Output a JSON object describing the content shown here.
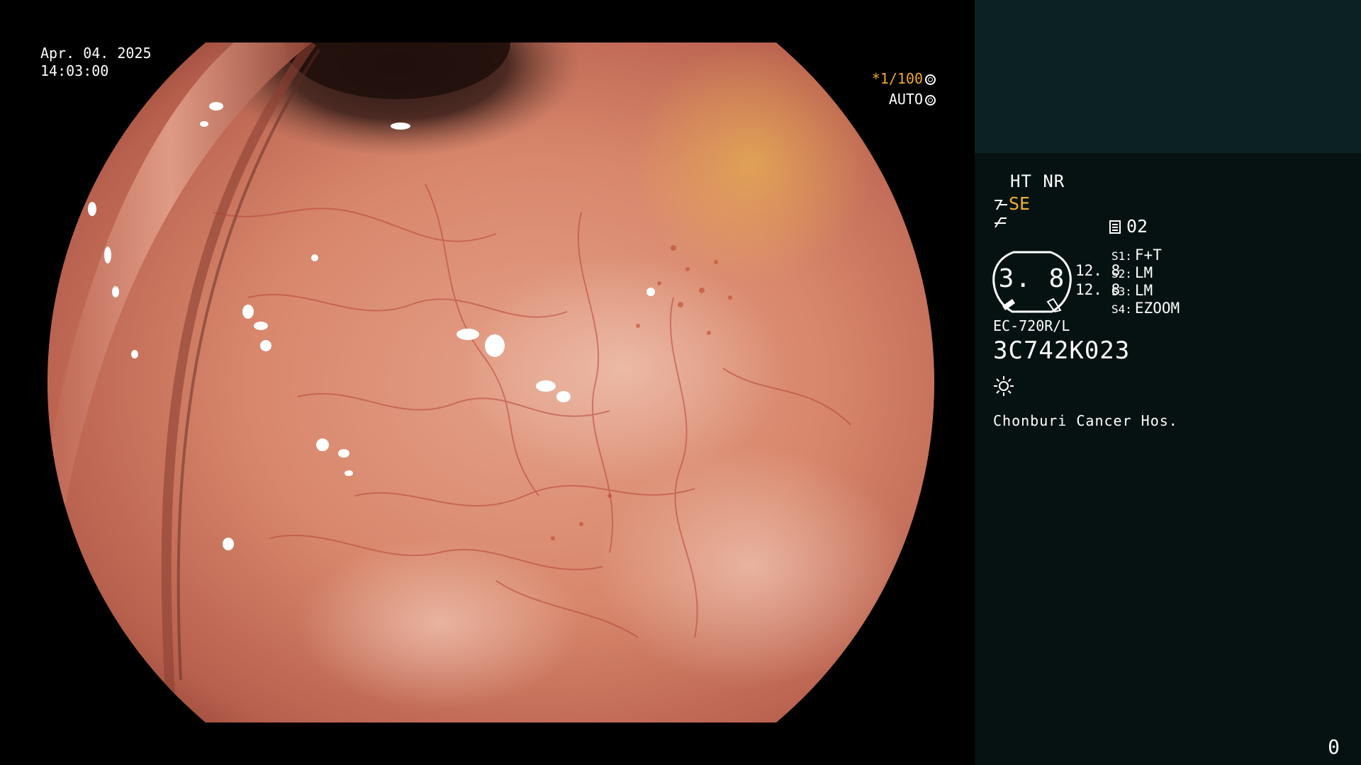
{
  "overlay": {
    "date": "Apr. 04. 2025",
    "time": "14:03:00",
    "shutter": "*1/100",
    "iris_mode": "AUTO"
  },
  "info_panel": {
    "mode": "HT NR",
    "enhancement": "SE",
    "memory_number": "02",
    "zoom_value": "3. 8",
    "contrast_values": [
      "12. 8",
      "12. 8"
    ],
    "switches": [
      {
        "key": "S1:",
        "value": "F+T"
      },
      {
        "key": "S2:",
        "value": "LM"
      },
      {
        "key": "S3:",
        "value": "LM"
      },
      {
        "key": "S4:",
        "value": "EZOOM"
      }
    ],
    "scope_model": "EC-720R/L",
    "scope_serial": "3C742K023",
    "hospital": "Chonburi Cancer Hos.",
    "counter": "0"
  },
  "colors": {
    "panel_header": "#0c2222",
    "panel_body": "#061212",
    "accent_orange": "#f0b030"
  },
  "icons": [
    "shutter-icon",
    "iris-icon",
    "hook-icon",
    "memory-icon",
    "zoom-gauge-icon",
    "light-icon"
  ]
}
